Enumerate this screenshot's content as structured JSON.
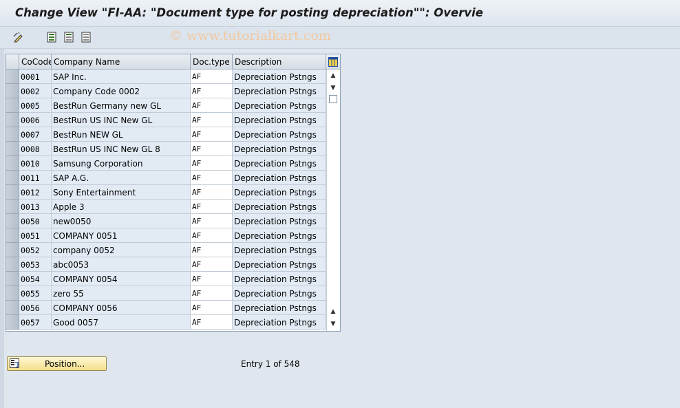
{
  "window": {
    "title": "Change View \"FI-AA: \"Document type for posting depreciation\"\": Overvie"
  },
  "watermark": "© www.tutorialkart.com",
  "toolbar": {
    "icons": [
      "edit-pencil-icon",
      "select-all-icon",
      "deselect-all-icon",
      "select-block-icon"
    ]
  },
  "table": {
    "headers": {
      "cocode": "CoCode",
      "company": "Company Name",
      "doctype": "Doc.type",
      "description": "Description"
    },
    "rows": [
      {
        "cocode": "0001",
        "company": "SAP Inc.",
        "doctype": "AF",
        "description": "Depreciation Pstngs"
      },
      {
        "cocode": "0002",
        "company": "Company Code 0002",
        "doctype": "AF",
        "description": "Depreciation Pstngs"
      },
      {
        "cocode": "0005",
        "company": "BestRun Germany new GL",
        "doctype": "AF",
        "description": "Depreciation Pstngs"
      },
      {
        "cocode": "0006",
        "company": "BestRun US INC New GL",
        "doctype": "AF",
        "description": "Depreciation Pstngs"
      },
      {
        "cocode": "0007",
        "company": "BestRun NEW GL",
        "doctype": "AF",
        "description": "Depreciation Pstngs"
      },
      {
        "cocode": "0008",
        "company": "BestRun US INC New GL 8",
        "doctype": "AF",
        "description": "Depreciation Pstngs"
      },
      {
        "cocode": "0010",
        "company": "Samsung Corporation",
        "doctype": "AF",
        "description": "Depreciation Pstngs"
      },
      {
        "cocode": "0011",
        "company": "SAP A.G.",
        "doctype": "AF",
        "description": "Depreciation Pstngs"
      },
      {
        "cocode": "0012",
        "company": "Sony Entertainment",
        "doctype": "AF",
        "description": "Depreciation Pstngs"
      },
      {
        "cocode": "0013",
        "company": "Apple 3",
        "doctype": "AF",
        "description": "Depreciation Pstngs"
      },
      {
        "cocode": "0050",
        "company": "new0050",
        "doctype": "AF",
        "description": "Depreciation Pstngs"
      },
      {
        "cocode": "0051",
        "company": "COMPANY 0051",
        "doctype": "AF",
        "description": "Depreciation Pstngs"
      },
      {
        "cocode": "0052",
        "company": "company 0052",
        "doctype": "AF",
        "description": "Depreciation Pstngs"
      },
      {
        "cocode": "0053",
        "company": "abc0053",
        "doctype": "AF",
        "description": "Depreciation Pstngs"
      },
      {
        "cocode": "0054",
        "company": "COMPANY 0054",
        "doctype": "AF",
        "description": "Depreciation Pstngs"
      },
      {
        "cocode": "0055",
        "company": "zero 55",
        "doctype": "AF",
        "description": "Depreciation Pstngs"
      },
      {
        "cocode": "0056",
        "company": "COMPANY 0056",
        "doctype": "AF",
        "description": "Depreciation Pstngs"
      },
      {
        "cocode": "0057",
        "company": "Good 0057",
        "doctype": "AF",
        "description": "Depreciation Pstngs"
      }
    ]
  },
  "footer": {
    "position_label": "Position...",
    "entry_text": "Entry 1 of 548"
  },
  "colors": {
    "accent": "#f3df8c",
    "title_bg": "#dde5ee",
    "row_bg": "#e2ebf4"
  }
}
